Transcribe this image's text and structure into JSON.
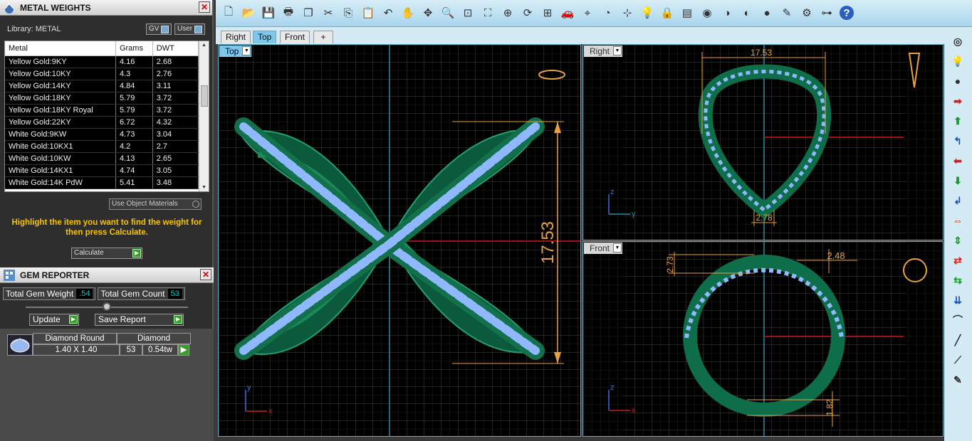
{
  "metal_panel": {
    "title": "METAL WEIGHTS",
    "library_label": "Library: METAL",
    "gv_label": "GV",
    "user_label": "User",
    "columns": [
      "Metal",
      "Grams",
      "DWT"
    ],
    "rows": [
      {
        "metal": "Yellow Gold:9KY",
        "grams": "4.16",
        "dwt": "2.68"
      },
      {
        "metal": "Yellow Gold:10KY",
        "grams": "4.3",
        "dwt": "2.76"
      },
      {
        "metal": "Yellow Gold:14KY",
        "grams": "4.84",
        "dwt": "3.11"
      },
      {
        "metal": "Yellow Gold:18KY",
        "grams": "5.79",
        "dwt": "3.72"
      },
      {
        "metal": "Yellow Gold:18KY Royal",
        "grams": "5.79",
        "dwt": "3.72"
      },
      {
        "metal": "Yellow Gold:22KY",
        "grams": "6.72",
        "dwt": "4.32"
      },
      {
        "metal": "White Gold:9KW",
        "grams": "4.73",
        "dwt": "3.04"
      },
      {
        "metal": "White Gold:10KX1",
        "grams": "4.2",
        "dwt": "2.7"
      },
      {
        "metal": "White Gold:10KW",
        "grams": "4.13",
        "dwt": "2.65"
      },
      {
        "metal": "White Gold:14KX1",
        "grams": "4.74",
        "dwt": "3.05"
      },
      {
        "metal": "White Gold:14K PdW",
        "grams": "5.41",
        "dwt": "3.48"
      }
    ],
    "use_object_materials": "Use Object Materials",
    "hint": "Highlight the item you want to find the weight for then press Calculate.",
    "calculate_label": "Calculate"
  },
  "gem_panel": {
    "title": "GEM REPORTER",
    "total_weight_label": "Total Gem Weight",
    "total_weight_value": ".54",
    "total_count_label": "Total Gem Count",
    "total_count_value": "53",
    "update_label": "Update",
    "save_report_label": "Save Report",
    "gem_shape": "Diamond Round",
    "gem_size": "1.40 X 1.40",
    "gem_type": "Diamond",
    "gem_count": "53",
    "gem_weight": "0.54tw"
  },
  "toolbar": {
    "icons": [
      "new-icon",
      "open-icon",
      "save-icon",
      "print-icon",
      "copy-doc-icon",
      "cut-icon",
      "copy-icon",
      "paste-icon",
      "undo-icon",
      "pan-hand-icon",
      "move-icon",
      "zoom-icon",
      "zoom-window-icon",
      "zoom-extents-icon",
      "zoom-selected-icon",
      "rotate-view-icon",
      "four-view-icon",
      "car-icon",
      "grid-snap-icon",
      "osnap-icon",
      "object-snap-icon",
      "light-icon",
      "lock-icon",
      "layer-icon",
      "color-wheel-icon",
      "shade-icon",
      "render-icon",
      "sphere-icon",
      "pencil-icon",
      "gear-icon",
      "tree-icon",
      "help-icon"
    ]
  },
  "tabs": [
    "Right",
    "Top",
    "Front",
    "+"
  ],
  "active_tab": "Top",
  "viewports": {
    "top": {
      "label": "Top",
      "dimension": "17.53",
      "axis_x": "x",
      "axis_y": "y"
    },
    "right": {
      "label": "Right",
      "dimension_top": "17.53",
      "dimension_bottom": "2.78",
      "axis_z": "z",
      "axis_y": "y"
    },
    "front": {
      "label": "Front",
      "dimension_left": "2.73",
      "dimension_right": "2.48",
      "dimension_bottom": "1.82",
      "axis_z": "z",
      "axis_x": "x"
    }
  },
  "right_toolbar": {
    "icons": [
      "camera-icon",
      "lightbulb-icon",
      "sphere-icon",
      "arrow-right-icon",
      "arrow-up-icon",
      "arrow-upleft-icon",
      "arrow-left-icon",
      "arrow-down-icon",
      "arrow-downleft-icon",
      "arrow-leftright-icon",
      "arrow-updown-icon",
      "arrow-split-icon",
      "arrow-merge-icon",
      "arrow-converge-icon",
      "curve-icon",
      "line-icon",
      "line-angle-icon",
      "brush-icon"
    ]
  },
  "colors": {
    "ring_green": "#0f6e4a",
    "gem_blue": "#8fb8ff",
    "dim_orange": "#e8a040",
    "accent_blue": "#7ec7e8",
    "hint_yellow": "#f5c400"
  }
}
